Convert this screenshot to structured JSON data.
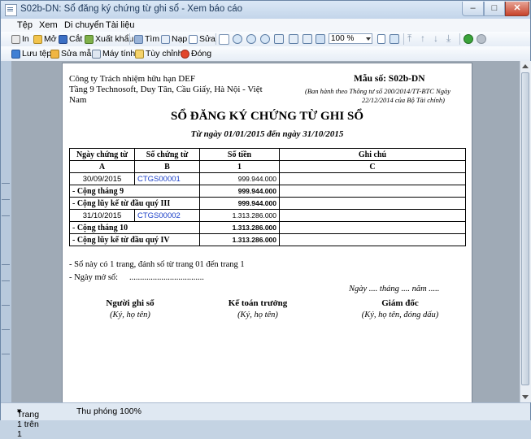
{
  "window": {
    "title": "S02b-DN: Sổ đăng ký chứng từ ghi sổ - Xem báo cáo"
  },
  "menu": [
    "Tệp",
    "Xem",
    "Di chuyển",
    "Tài liệu"
  ],
  "toolbar1": {
    "print": "In",
    "open": "Mở",
    "cut": "Cắt",
    "export": "Xuất khẩu",
    "find": "Tìm",
    "load": "Nạp",
    "edit": "Sửa",
    "zoom": "100 %"
  },
  "toolbar2": {
    "save": "Lưu tệp",
    "edit_template": "Sửa mẫu",
    "printer": "Máy tính",
    "customize": "Tùy chỉnh",
    "close": "Đóng"
  },
  "report": {
    "company": "Công ty Trách nhiệm hữu hạn DEF",
    "address_line1": "Tầng 9 Technosoft, Duy Tân, Cầu Giấy, Hà Nội - Việt",
    "address_line2": "Nam",
    "form_no": "Mẫu số: S02b-DN",
    "form_note_line1": "(Ban hành theo Thông tư số 200/2014/TT-BTC  Ngày",
    "form_note_line2": "22/12/2014 của Bộ Tài chính)",
    "title": "SỔ ĐĂNG KÝ CHỨNG TỪ GHI SỔ",
    "period": "Từ ngày 01/01/2015 đến ngày 31/10/2015",
    "columns": [
      "Ngày chứng từ",
      "Số chứng từ",
      "Số tiền",
      "Ghi chú"
    ],
    "column_codes": [
      "A",
      "B",
      "1",
      "C"
    ],
    "rows": [
      {
        "type": "entry",
        "date": "30/09/2015",
        "doc": "CTGS00001",
        "amount": "999.944.000",
        "note": ""
      },
      {
        "type": "total",
        "label": "- Cộng tháng 9",
        "amount": "999.944.000"
      },
      {
        "type": "total",
        "label": "- Cộng lũy kế từ đầu quý III",
        "amount": "999.944.000"
      },
      {
        "type": "entry",
        "date": "31/10/2015",
        "doc": "CTGS00002",
        "amount": "1.313.286.000",
        "note": ""
      },
      {
        "type": "total",
        "label": "- Cộng tháng 10",
        "amount": "1.313.286.000"
      },
      {
        "type": "total",
        "label": "- Cộng lũy kế từ đầu quý IV",
        "amount": "1.313.286.000"
      }
    ],
    "note1": "- Sổ này có 1 trang, đánh số từ trang 01 đến trang 1",
    "note2_label": "- Ngày mở sổ:",
    "note2_dots": "...................................",
    "date_line": "Ngày .... tháng .... năm .....",
    "sig1_title": "Người ghi sổ",
    "sig1_sub": "(Ký, họ tên)",
    "sig2_title": "Kế toán trưởng",
    "sig2_sub": "(Ký, họ tên)",
    "sig3_title": "Giám đốc",
    "sig3_sub": "(Ký, họ tên, đóng dấu)"
  },
  "status": {
    "page": "Trang 1 trên 1",
    "zoom": "Thu phóng 100%"
  }
}
